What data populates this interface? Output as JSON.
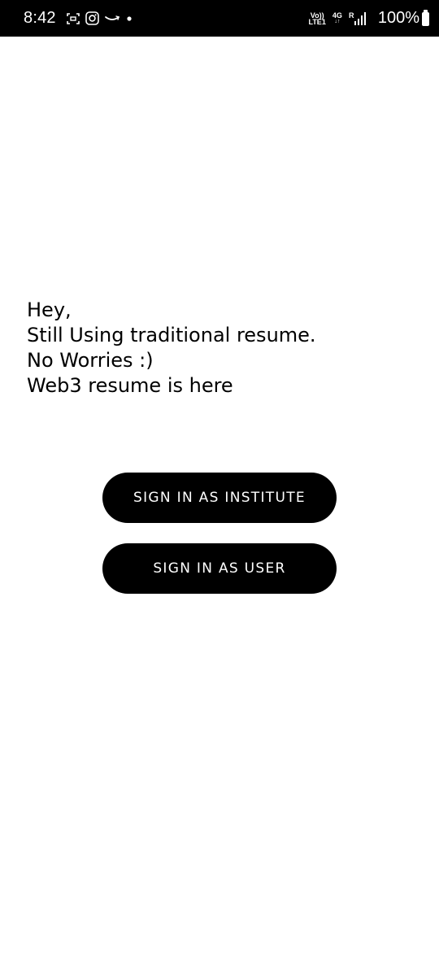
{
  "status_bar": {
    "time": "8:42",
    "left_icons": [
      "screenshot-icon",
      "instagram-icon",
      "amazon-icon",
      "notification-dot-icon"
    ],
    "network_top": "Vo)) 4G R",
    "network_line1": "Vo))",
    "network_line2": "LTE1",
    "network_type": "4G",
    "roaming": "R",
    "battery": "100%"
  },
  "greeting": {
    "lines": [
      "Hey,",
      "Still Using traditional resume.",
      "No Worries :)",
      "Web3 resume is here"
    ]
  },
  "buttons": {
    "institute_label": "SIGN IN AS INSTITUTE",
    "user_label": "SIGN IN AS USER"
  },
  "colors": {
    "background": "#ffffff",
    "status_bar": "#000000",
    "button_bg": "#000000",
    "button_text": "#ffffff",
    "text": "#000000"
  }
}
